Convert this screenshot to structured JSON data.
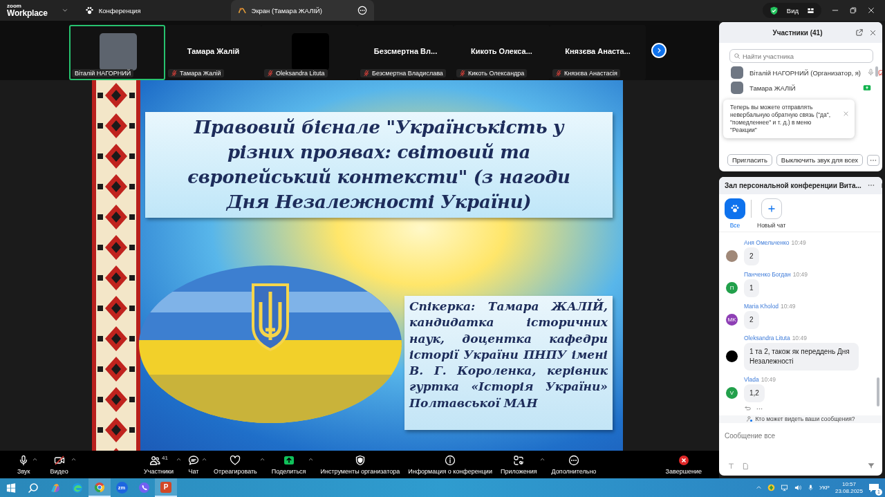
{
  "app": {
    "logo_top": "zoom",
    "logo_bottom": "Workplace"
  },
  "top_tabs": [
    {
      "label": "Конференция",
      "kind": "conference",
      "selected": false
    },
    {
      "label": "Экран (Тамара ЖАЛІЙ)",
      "kind": "screen",
      "selected": true
    }
  ],
  "view_button": "Вид",
  "video_tiles": [
    {
      "kind": "video",
      "name": "Віталій НАГОРНИЙ",
      "muted": false,
      "speaking": true
    },
    {
      "kind": "name",
      "display": "Тамара Жалій",
      "name": "Тамара Жалій",
      "muted": true,
      "speaking": false
    },
    {
      "kind": "blank",
      "name": "Oleksandra Lituta",
      "muted": true,
      "speaking": false
    },
    {
      "kind": "name",
      "display": "Безсмертна Вл...",
      "name": "Безсмертна Владислава",
      "muted": true,
      "speaking": false
    },
    {
      "kind": "name",
      "display": "Кикоть Олекса...",
      "name": "Кикоть Олександра",
      "muted": true,
      "speaking": false
    },
    {
      "kind": "name",
      "display": "Князєва Анаста...",
      "name": "Князєва Анастасія",
      "muted": true,
      "speaking": false
    }
  ],
  "slide": {
    "title": "Правовий бієнале \"Українськість у різних проявах: світовий та європейський контексти\" (з нагоди Дня Незалежності України)",
    "speaker": "Спікерка: Тамара ЖАЛІЙ, кандидатка історичних наук, доцентка кафедри історії України ПНПУ імені В. Г. Короленка, керівник гуртка «Історія України» Полтавської МАН"
  },
  "participants": {
    "title": "Участники (41)",
    "search_placeholder": "Найти участника",
    "rows": [
      {
        "name": "Віталій НАГОРНИЙ (Организатор, я)",
        "kind": "camera_off"
      },
      {
        "name": "Тамара ЖАЛІЙ",
        "kind": "sharing"
      }
    ],
    "toast": "Теперь вы можете отправлять невербальную обратную связь (\"да\", \"помедленнее\" и т. д.) в меню \"Реакции\"",
    "buttons": [
      "Пригласить",
      "Выключить звук для всех"
    ]
  },
  "chat": {
    "title": "Зал персональной конференции Вита...",
    "tabs": [
      {
        "label": "Все",
        "kind": "all",
        "selected": true
      },
      {
        "label": "Новый чат",
        "kind": "new",
        "selected": false
      }
    ],
    "messages": [
      {
        "sender": "Аня Омельченко",
        "time": "10:49",
        "text": "2",
        "kind": "photo"
      },
      {
        "sender": "Панченко Богдан",
        "time": "10:49",
        "text": "1",
        "kind": "initials",
        "initials": "П",
        "color": "#22a04b"
      },
      {
        "sender": "Maria Kholod",
        "time": "10:49",
        "text": "2",
        "kind": "initials",
        "initials": "MK",
        "color": "#8e3fb5"
      },
      {
        "sender": "Oleksandra Lituta",
        "time": "10:49",
        "text": "1 та 2, також як переддень Дня Незалежності",
        "kind": "blank",
        "color": "#000000"
      },
      {
        "sender": "Vlada",
        "time": "10:49",
        "text": "1,2",
        "kind": "initials",
        "initials": "V",
        "color": "#22a04b"
      }
    ],
    "privacy_note": "Кто может видеть ваши сообщения?",
    "input_placeholder": "Сообщение все"
  },
  "toolbar": [
    {
      "label": "Звук",
      "kind": "audio",
      "caret": true
    },
    {
      "label": "Видео",
      "kind": "video",
      "caret": true
    },
    {
      "label": "Участники",
      "kind": "participants",
      "badge": "41",
      "caret": true
    },
    {
      "label": "Чат",
      "kind": "chat",
      "caret": true
    },
    {
      "label": "Отреагировать",
      "kind": "react",
      "caret": true
    },
    {
      "label": "Поделиться",
      "kind": "share",
      "caret": true
    },
    {
      "label": "Инструменты организатора",
      "kind": "host_tools",
      "caret": false
    },
    {
      "label": "Информация о конференции",
      "kind": "info",
      "caret": false
    },
    {
      "label": "Приложения",
      "kind": "apps",
      "caret": true
    },
    {
      "label": "Дополнительно",
      "kind": "more",
      "caret": false
    },
    {
      "label": "Завершение",
      "kind": "end"
    }
  ],
  "taskbar": {
    "apps": [
      {
        "kind": "start"
      },
      {
        "kind": "search"
      },
      {
        "kind": "copilot"
      },
      {
        "kind": "edge"
      },
      {
        "kind": "chrome",
        "selected": true
      },
      {
        "kind": "zoom",
        "label": "zm",
        "selected": false
      },
      {
        "kind": "viber",
        "selected": false
      },
      {
        "kind": "powerpoint",
        "label": "P",
        "selected": true
      }
    ],
    "language": "УКР",
    "time": "10:57",
    "date": "23.08.2025",
    "notifications": "1"
  }
}
